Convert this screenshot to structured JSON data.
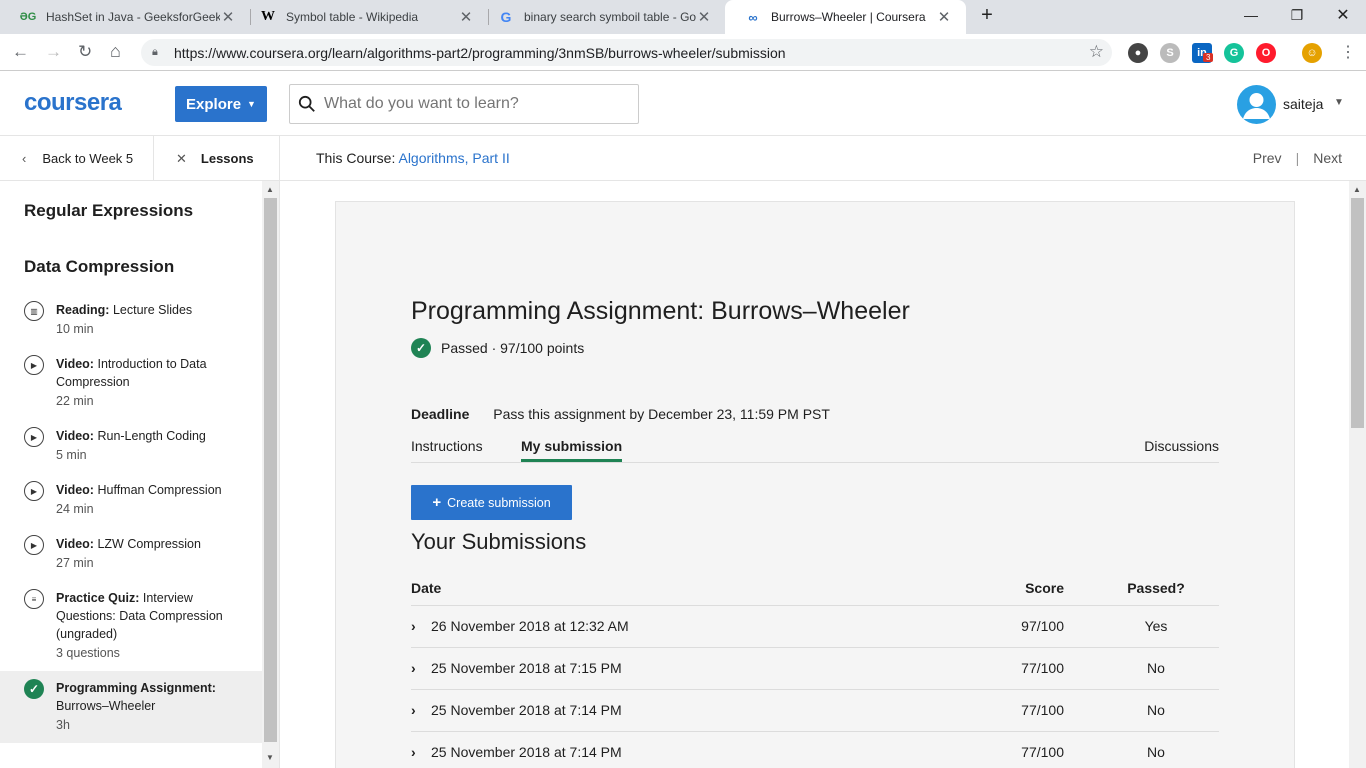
{
  "browser": {
    "tabs": [
      {
        "title": "HashSet in Java - GeeksforGeeks",
        "favicon": "gfg-icon"
      },
      {
        "title": "Symbol table - Wikipedia",
        "favicon": "wikipedia-icon"
      },
      {
        "title": "binary search symboil table - Goo",
        "favicon": "google-icon"
      },
      {
        "title": "Burrows–Wheeler | Coursera",
        "favicon": "coursera-icon"
      }
    ],
    "url": "https://www.coursera.org/learn/algorithms-part2/programming/3nmSB/burrows-wheeler/submission",
    "extension_badges": {
      "linkedin": "3"
    }
  },
  "header": {
    "logo": "coursera",
    "explore_label": "Explore",
    "search_placeholder": "What do you want to learn?",
    "user_name": "saiteja"
  },
  "subnav": {
    "back_label": "Back to Week 5",
    "lessons_label": "Lessons",
    "this_course_prefix": "This Course:",
    "course_name": "Algorithms, Part II",
    "prev_label": "Prev",
    "next_label": "Next"
  },
  "sidebar": {
    "sections": [
      "Regular Expressions",
      "Data Compression"
    ],
    "items": [
      {
        "type": "Reading:",
        "title": "Lecture Slides",
        "duration": "10 min",
        "icon": "book-icon"
      },
      {
        "type": "Video:",
        "title": "Introduction to Data Compression",
        "duration": "22 min",
        "icon": "play-icon"
      },
      {
        "type": "Video:",
        "title": "Run-Length Coding",
        "duration": "5 min",
        "icon": "play-icon"
      },
      {
        "type": "Video:",
        "title": "Huffman Compression",
        "duration": "24 min",
        "icon": "play-icon"
      },
      {
        "type": "Video:",
        "title": "LZW Compression",
        "duration": "27 min",
        "icon": "play-icon"
      },
      {
        "type": "Practice Quiz:",
        "title": "Interview Questions: Data Compression (ungraded)",
        "duration": "3 questions",
        "icon": "quiz-icon"
      },
      {
        "type": "Programming Assignment:",
        "title": "Burrows–Wheeler",
        "duration": "3h",
        "icon": "check-circle-icon"
      }
    ]
  },
  "assignment": {
    "title": "Programming Assignment: Burrows–Wheeler",
    "status": "Passed · 97/100 points",
    "deadline_label": "Deadline",
    "deadline_text": "Pass this assignment by December 23, 11:59 PM PST",
    "tabs": [
      "Instructions",
      "My submission",
      "Discussions"
    ],
    "active_tab": "My submission",
    "create_label": "Create submission",
    "submissions_heading": "Your Submissions",
    "columns": [
      "Date",
      "Score",
      "Passed?"
    ],
    "rows": [
      {
        "date": "26 November 2018 at 12:32 AM",
        "score": "97/100",
        "passed": "Yes"
      },
      {
        "date": "25 November 2018 at 7:15 PM",
        "score": "77/100",
        "passed": "No"
      },
      {
        "date": "25 November 2018 at 7:14 PM",
        "score": "77/100",
        "passed": "No"
      },
      {
        "date": "25 November 2018 at 7:14 PM",
        "score": "77/100",
        "passed": "No"
      }
    ]
  },
  "colors": {
    "brand": "#2a73cc",
    "success": "#1f8354"
  }
}
